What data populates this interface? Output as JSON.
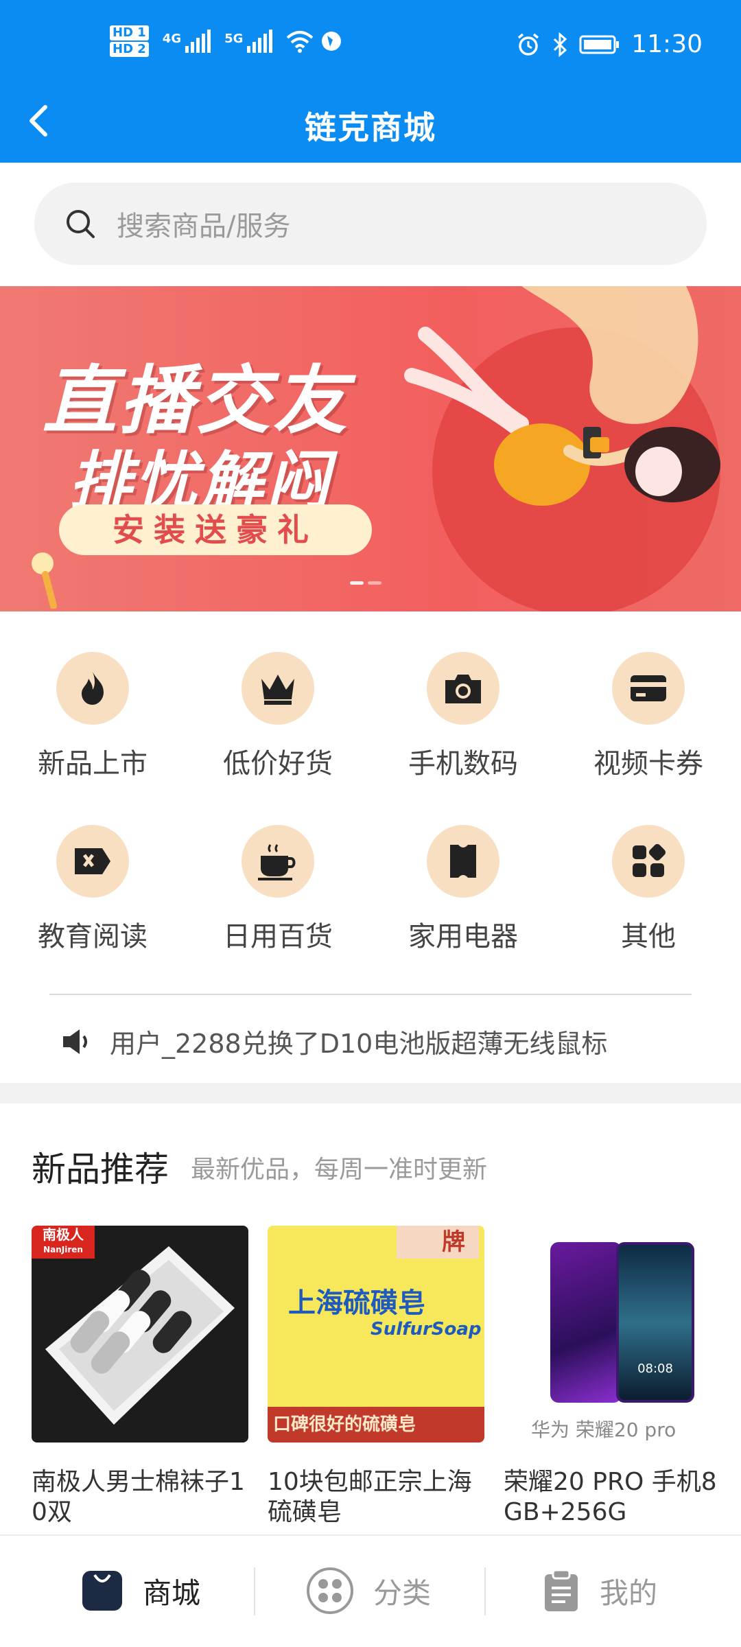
{
  "status_bar": {
    "time": "11:30",
    "hd1": "HD 1",
    "hd2": "HD 2",
    "net1": "4G",
    "net2": "5G"
  },
  "header": {
    "title": "链克商城"
  },
  "search": {
    "placeholder": "搜索商品/服务"
  },
  "banner": {
    "line1": "直播交友",
    "line2": "排忧解闷",
    "button": "安装送豪礼",
    "page_count": 2,
    "active_page": 1
  },
  "categories": [
    {
      "label": "新品上市",
      "icon": "fire-icon"
    },
    {
      "label": "低价好货",
      "icon": "crown-icon"
    },
    {
      "label": "手机数码",
      "icon": "camera-icon"
    },
    {
      "label": "视频卡券",
      "icon": "card-icon"
    },
    {
      "label": "教育阅读",
      "icon": "tag-icon"
    },
    {
      "label": "日用百货",
      "icon": "cup-icon"
    },
    {
      "label": "家用电器",
      "icon": "ticket-icon"
    },
    {
      "label": "其他",
      "icon": "grid-icon"
    }
  ],
  "notice": {
    "text": "用户_2288兑换了D10电池版超薄无线鼠标"
  },
  "section": {
    "title": "新品推荐",
    "subtitle": "最新优品，每周一准时更新"
  },
  "products": [
    {
      "name": "南极人男士棉袜子10双",
      "brand_badge": "南极人",
      "brand_badge_sub": "NanJiren"
    },
    {
      "name": "10块包邮正宗上海硫磺皂",
      "package_text": "上海硫磺皂",
      "package_en": "SulfurSoap",
      "package_band": "口碑很好的硫磺皂",
      "package_tag": "牌"
    },
    {
      "name": "荣耀20 PRO 手机8GB+256G",
      "phone_time": "08:08",
      "caption": "华为 荣耀20 pro"
    }
  ],
  "bottom_nav": [
    {
      "label": "商城",
      "icon": "bag-icon",
      "active": true
    },
    {
      "label": "分类",
      "icon": "category-icon",
      "active": false
    },
    {
      "label": "我的",
      "icon": "clipboard-icon",
      "active": false
    }
  ],
  "colors": {
    "primary": "#0a8cf2",
    "icon_bg": "#f8dfc2",
    "banner": "#f25f5e"
  }
}
